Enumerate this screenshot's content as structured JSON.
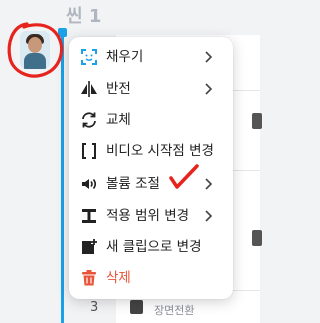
{
  "scene": {
    "title": "씬 1"
  },
  "timeline": {
    "row_number": "3",
    "row_label": "장면전환"
  },
  "menu": {
    "items": [
      {
        "label": "채우기",
        "icon": "face-frame-icon",
        "submenu": true
      },
      {
        "label": "반전",
        "icon": "flip-icon",
        "submenu": true
      },
      {
        "label": "교체",
        "icon": "replace-icon",
        "submenu": false
      },
      {
        "label": "비디오 시작점 변경",
        "icon": "bracket-icon",
        "submenu": false
      },
      {
        "label": "볼륨 조절",
        "icon": "volume-icon",
        "submenu": true
      },
      {
        "label": "적용 범위 변경",
        "icon": "range-icon",
        "submenu": true
      },
      {
        "label": "새 클립으로 변경",
        "icon": "new-clip-icon",
        "submenu": false
      },
      {
        "label": "삭제",
        "icon": "trash-icon",
        "submenu": false
      }
    ]
  },
  "colors": {
    "accent": "#1aa1e8",
    "danger": "#e8543a",
    "annotation": "#e6231c"
  }
}
